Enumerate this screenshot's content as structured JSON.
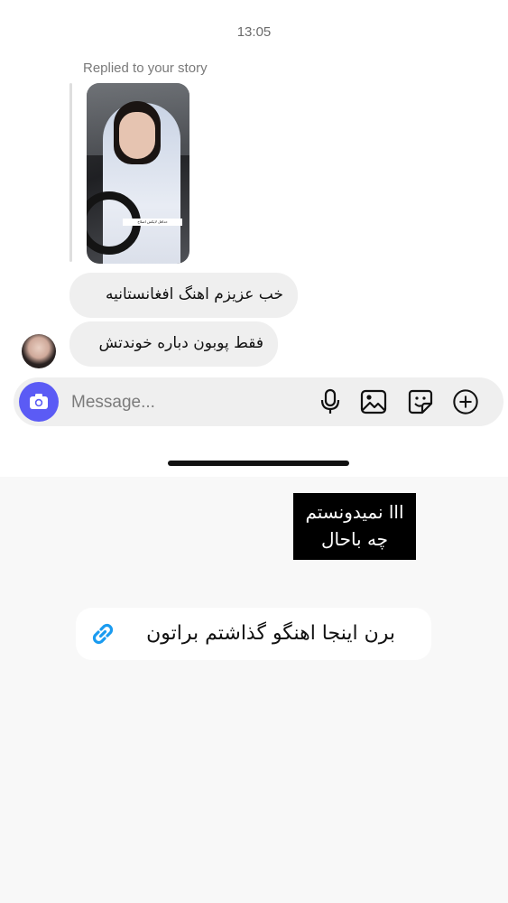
{
  "chat": {
    "timestamp": "13:05",
    "replied_label": "Replied to your story",
    "story": {
      "caption": "حداقل لایکش اصلاح"
    },
    "messages": [
      {
        "text": "خب عزیزم اهنگ افغانستانیه"
      },
      {
        "text": "فقط پوبون دباره خوندتش"
      }
    ]
  },
  "composer": {
    "placeholder": "Message...",
    "icons": [
      "camera-icon",
      "microphone-icon",
      "gallery-icon",
      "sticker-icon",
      "plus-icon"
    ]
  },
  "overlay": {
    "text_box": {
      "line1": "ااا نمیدونستم",
      "line2": "چه باحال"
    },
    "link_sticker": {
      "label": "برن اینجا اهنگو گذاشتم براتون",
      "icon": "link-icon"
    }
  },
  "colors": {
    "accent": "#5b5bf5",
    "bubble": "#efefef",
    "link": "#1a9bf0"
  }
}
